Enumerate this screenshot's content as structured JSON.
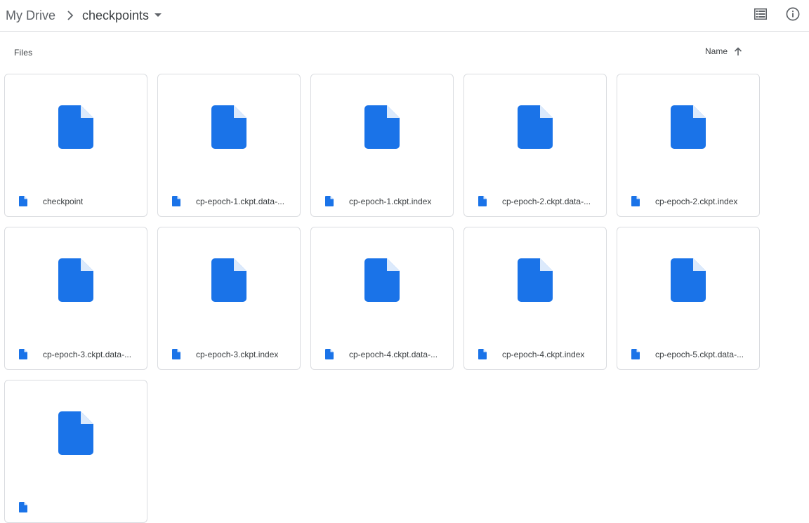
{
  "breadcrumb": {
    "root": "My Drive",
    "current": "checkpoints"
  },
  "toolbar": {
    "list_view_icon": "list-view-icon",
    "info_icon": "info-icon"
  },
  "section": {
    "label": "Files",
    "sort_label": "Name",
    "sort_direction": "ascending"
  },
  "colors": {
    "file_icon": "#1a73e8",
    "border": "#dadce0",
    "text": "#3c4043"
  },
  "files": [
    {
      "name": "checkpoint"
    },
    {
      "name": "cp-epoch-1.ckpt.data-..."
    },
    {
      "name": "cp-epoch-1.ckpt.index"
    },
    {
      "name": "cp-epoch-2.ckpt.data-..."
    },
    {
      "name": "cp-epoch-2.ckpt.index"
    },
    {
      "name": "cp-epoch-3.ckpt.data-..."
    },
    {
      "name": "cp-epoch-3.ckpt.index"
    },
    {
      "name": "cp-epoch-4.ckpt.data-..."
    },
    {
      "name": "cp-epoch-4.ckpt.index"
    },
    {
      "name": "cp-epoch-5.ckpt.data-..."
    },
    {
      "name": ""
    }
  ]
}
